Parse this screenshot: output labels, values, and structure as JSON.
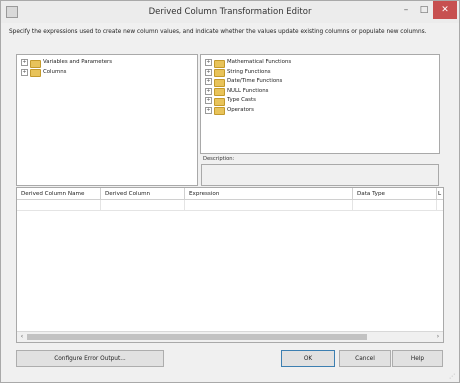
{
  "window": {
    "title": "Derived Column Transformation Editor",
    "minimize": "–",
    "maximize": "□",
    "close": "✕"
  },
  "instructions": "Specify the expressions used to create new column values, and indicate whether the values update existing columns or populate new columns.",
  "left_tree": {
    "items": [
      {
        "label": "Variables and Parameters",
        "expander": "+"
      },
      {
        "label": "Columns",
        "expander": "+"
      }
    ]
  },
  "right_tree": {
    "items": [
      {
        "label": "Mathematical Functions",
        "expander": "+"
      },
      {
        "label": "String Functions",
        "expander": "+"
      },
      {
        "label": "Date/Time Functions",
        "expander": "+"
      },
      {
        "label": "NULL Functions",
        "expander": "+"
      },
      {
        "label": "Type Casts",
        "expander": "+"
      },
      {
        "label": "Operators",
        "expander": "+"
      }
    ]
  },
  "description": {
    "label": "Description:",
    "value": ""
  },
  "grid": {
    "columns": [
      "Derived Column Name",
      "Derived Column",
      "Expression",
      "Data Type",
      "L"
    ],
    "rows": []
  },
  "scrollbar": {
    "left_arrow": "‹",
    "right_arrow": "›"
  },
  "buttons": {
    "configure_error_output": "Configure Error Output...",
    "ok": "OK",
    "cancel": "Cancel",
    "help": "Help"
  }
}
